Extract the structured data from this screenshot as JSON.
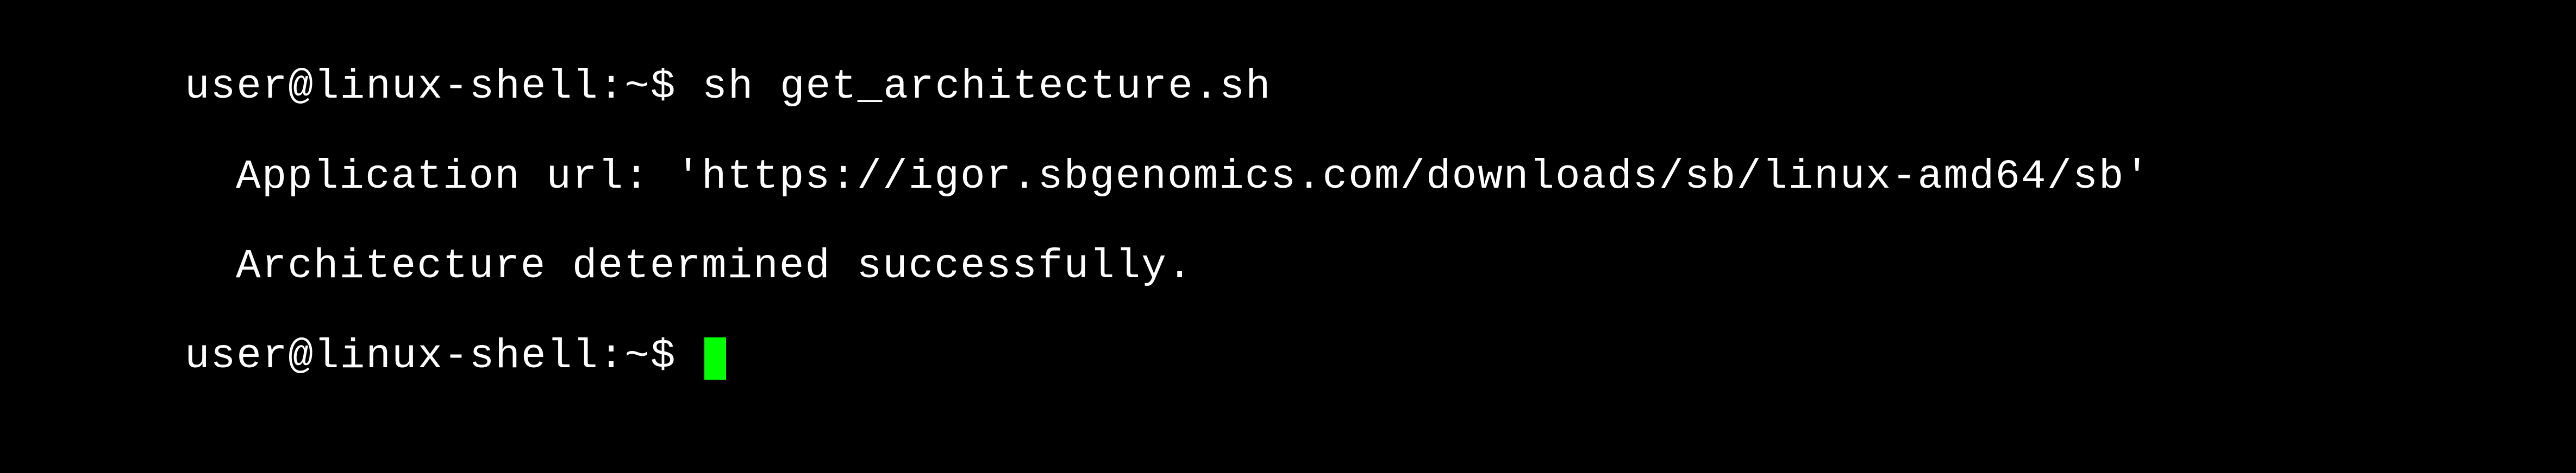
{
  "terminal": {
    "prompt": "user@linux-shell:~$ ",
    "command": "sh get_architecture.sh",
    "output_lines": [
      "Application url: 'https://igor.sbgenomics.com/downloads/sb/linux-amd64/sb'",
      "Architecture determined successfully."
    ],
    "prompt2": "user@linux-shell:~$ "
  }
}
